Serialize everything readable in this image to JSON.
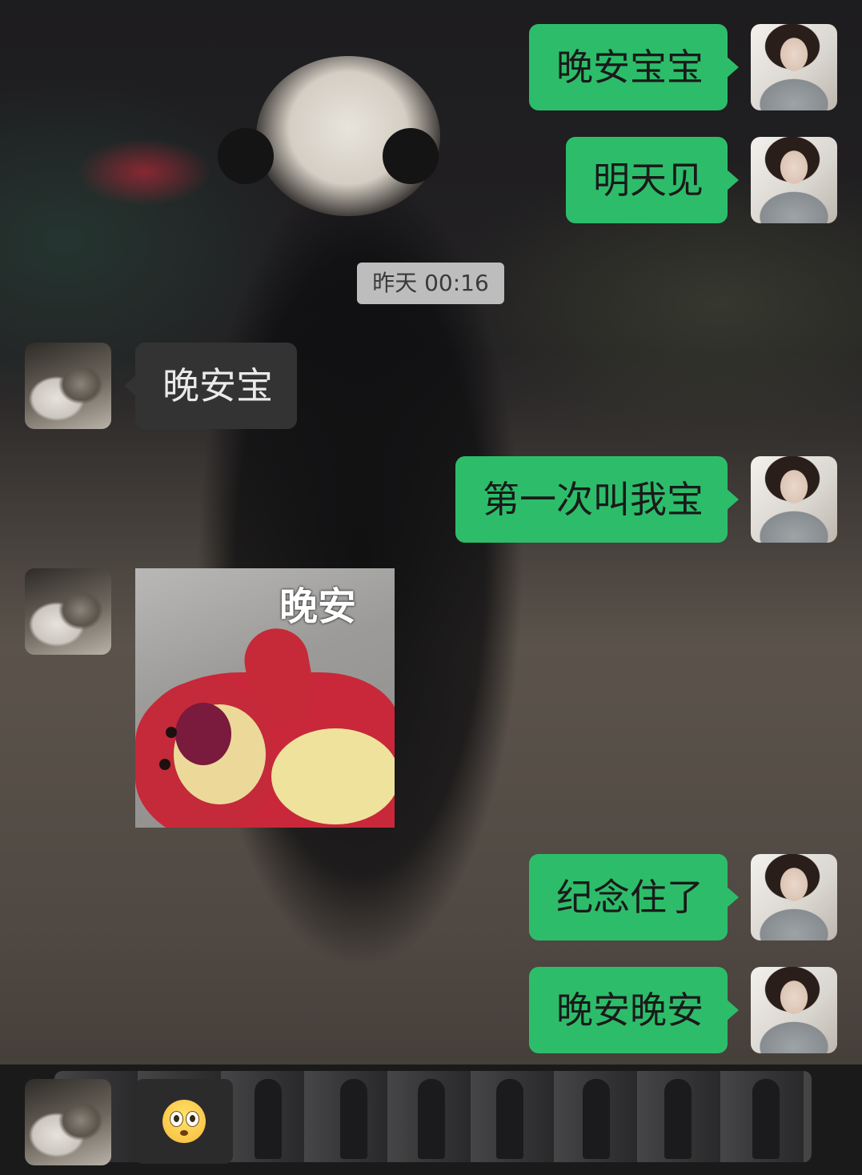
{
  "timestamp": "昨天 00:16",
  "messages": [
    {
      "side": "me",
      "text": "晚安宝宝"
    },
    {
      "side": "me",
      "text": "明天见"
    },
    {
      "side": "them",
      "text": "晚安宝"
    },
    {
      "side": "me",
      "text": "第一次叫我宝"
    },
    {
      "side": "them",
      "type": "sticker",
      "caption": "晚安"
    },
    {
      "side": "me",
      "text": "纪念住了"
    },
    {
      "side": "me",
      "text": "晚安晚安"
    }
  ],
  "colors": {
    "my_bubble": "#2dbd6a",
    "their_bubble": "#333334",
    "timestamp_bg": "#bdbdbd"
  },
  "bottom_bar": {
    "emoji_icon": "flushed-face-icon"
  }
}
